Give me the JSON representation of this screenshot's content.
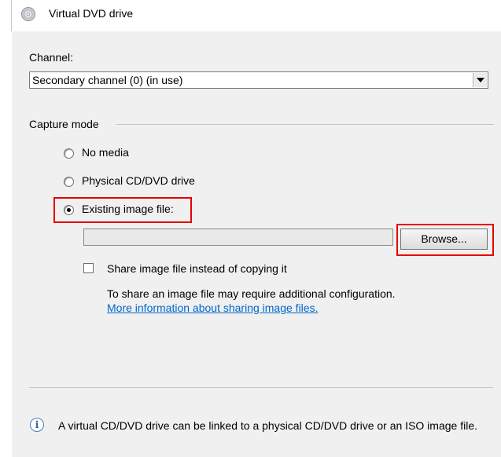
{
  "header": {
    "title": "Virtual DVD drive",
    "icon": "dvd-drive-icon"
  },
  "channel": {
    "label": "Channel:",
    "selected": "Secondary channel (0) (in use)"
  },
  "capture_mode": {
    "label": "Capture mode",
    "options": [
      {
        "label": "No media",
        "selected": false
      },
      {
        "label": "Physical CD/DVD drive",
        "selected": false
      },
      {
        "label": "Existing image file:",
        "selected": true
      }
    ],
    "image_path": "",
    "browse_label": "Browse...",
    "share_checkbox_label": "Share image file instead of copying it",
    "share_checked": false,
    "share_note": "To share an image file may require additional configuration.",
    "share_link": "More information about sharing image files."
  },
  "footer": {
    "info_text": "A virtual CD/DVD drive can be linked to a physical CD/DVD drive or an ISO image file."
  },
  "colors": {
    "panel_bg": "#f0f0f0",
    "highlight": "#e60000",
    "link": "#0066cc"
  }
}
